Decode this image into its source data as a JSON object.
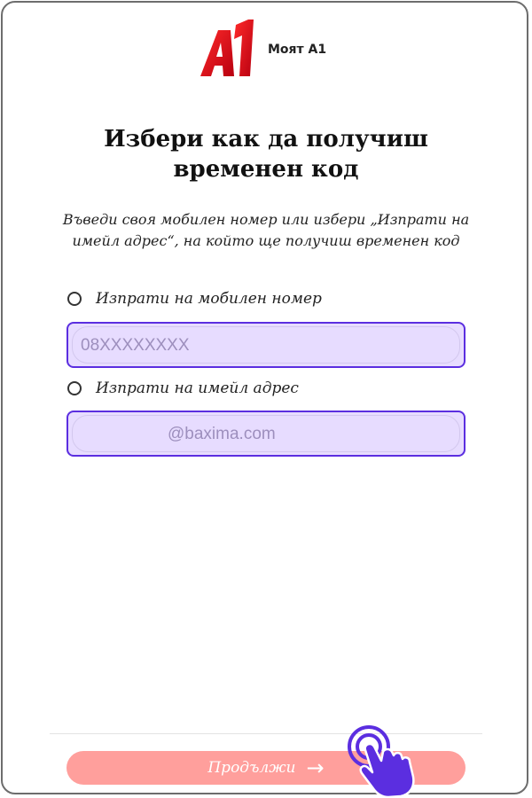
{
  "brand": {
    "logo_text": "A1",
    "app_name": "Моят А1",
    "logo_color": "#e30613"
  },
  "page": {
    "title_line1": "Избери как да получиш",
    "title_line2": "временен код",
    "subtitle": "Въведи своя мобилен номер или избери „Изпрати на имейл адрес“, на който ще получиш временен код"
  },
  "options": {
    "mobile_label": "Изпрати на мобилен номер",
    "mobile_placeholder": "08XXXXXXXX",
    "email_label": "Изпрати на имейл адрес",
    "email_placeholder": "@baxima.com"
  },
  "actions": {
    "continue_label": "Продължи",
    "continue_arrow": "→"
  },
  "colors": {
    "accent": "#5b2ee0",
    "field_bg": "#e7dcff",
    "button_bg": "#ff9f9c",
    "hand_cursor": "#5b2ee0"
  }
}
